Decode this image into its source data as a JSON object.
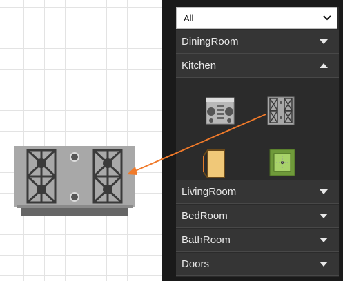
{
  "filter": {
    "selected": "All",
    "dropdown_icon": "chevron-down-icon"
  },
  "categories": [
    {
      "label": "DiningRoom",
      "state": "collapsed"
    },
    {
      "label": "Kitchen",
      "state": "expanded"
    },
    {
      "label": "LivingRoom",
      "state": "collapsed"
    },
    {
      "label": "BedRoom",
      "state": "collapsed"
    },
    {
      "label": "BathRoom",
      "state": "collapsed"
    },
    {
      "label": "Doors",
      "state": "collapsed"
    }
  ],
  "kitchen_items": [
    {
      "icon": "oven-front-icon"
    },
    {
      "icon": "stove-top-icon"
    },
    {
      "icon": "fridge-icon"
    },
    {
      "icon": "sink-icon"
    }
  ],
  "colors": {
    "accent_arrow": "#f07a2a",
    "panel_bg": "#2b2b2b",
    "header_bg": "#353535"
  }
}
